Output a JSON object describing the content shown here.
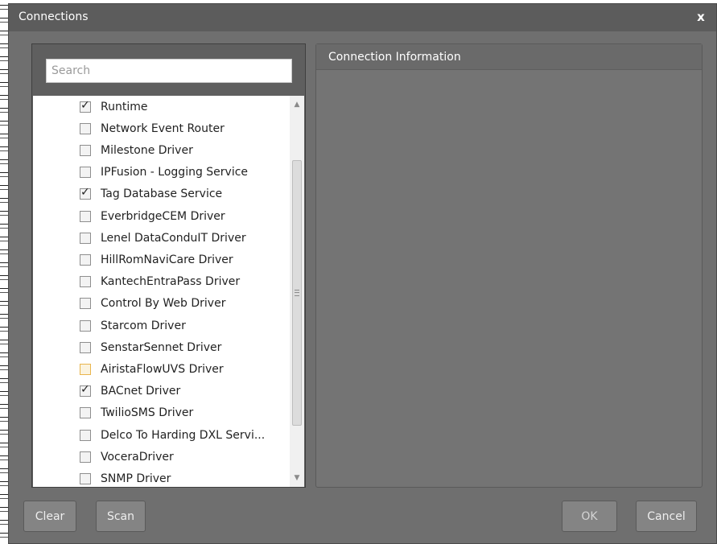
{
  "window": {
    "title": "Connections",
    "close_label": "x"
  },
  "search": {
    "placeholder": "Search",
    "value": ""
  },
  "connections": [
    {
      "label": "Runtime",
      "checked": true
    },
    {
      "label": "Network Event Router",
      "checked": false
    },
    {
      "label": "Milestone Driver",
      "checked": false
    },
    {
      "label": "IPFusion - Logging Service",
      "checked": false
    },
    {
      "label": "Tag Database Service",
      "checked": true
    },
    {
      "label": "EverbridgeCEM Driver",
      "checked": false
    },
    {
      "label": "Lenel DataConduIT Driver",
      "checked": false
    },
    {
      "label": "HillRomNaviCare Driver",
      "checked": false
    },
    {
      "label": "KantechEntraPass Driver",
      "checked": false
    },
    {
      "label": "Control By Web Driver",
      "checked": false
    },
    {
      "label": "Starcom Driver",
      "checked": false
    },
    {
      "label": "SenstarSennet Driver",
      "checked": false
    },
    {
      "label": "AiristaFlowUVS Driver",
      "checked": false,
      "focused": true
    },
    {
      "label": "BACnet Driver",
      "checked": true
    },
    {
      "label": "TwilioSMS Driver",
      "checked": false
    },
    {
      "label": "Delco To Harding DXL Servi...",
      "checked": false
    },
    {
      "label": "VoceraDriver",
      "checked": false
    },
    {
      "label": "SNMP Driver",
      "checked": false
    }
  ],
  "info_panel": {
    "header": "Connection Information"
  },
  "buttons": {
    "clear": "Clear",
    "scan": "Scan",
    "ok": "OK",
    "cancel": "Cancel"
  },
  "icons": {
    "scroll_up": "▲",
    "scroll_down": "▼"
  }
}
